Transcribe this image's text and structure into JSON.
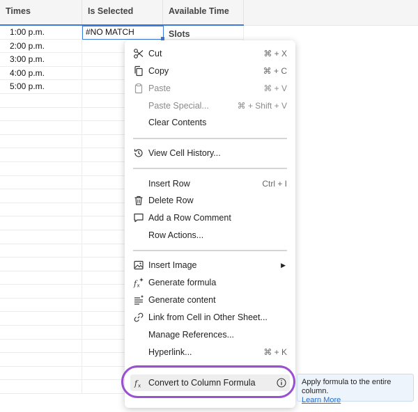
{
  "columns": [
    "Times",
    "Is Selected",
    "Available Time Slots"
  ],
  "rows": [
    {
      "time": "1:00 p.m.",
      "selected": "#NO MATCH",
      "slot": ""
    },
    {
      "time": "2:00 p.m.",
      "selected": "",
      "slot": ""
    },
    {
      "time": "3:00 p.m.",
      "selected": "",
      "slot": ""
    },
    {
      "time": "4:00 p.m.",
      "selected": "",
      "slot": ""
    },
    {
      "time": "5:00 p.m.",
      "selected": "",
      "slot": ""
    }
  ],
  "active_cell": "#NO MATCH",
  "menu": {
    "cut": {
      "label": "Cut",
      "shortcut": "⌘ + X"
    },
    "copy": {
      "label": "Copy",
      "shortcut": "⌘ + C"
    },
    "paste": {
      "label": "Paste",
      "shortcut": "⌘ + V"
    },
    "paste_special": {
      "label": "Paste Special...",
      "shortcut": "⌘ + Shift + V"
    },
    "clear_contents": {
      "label": "Clear Contents"
    },
    "view_history": {
      "label": "View Cell History..."
    },
    "insert_row": {
      "label": "Insert Row",
      "shortcut": "Ctrl + I"
    },
    "delete_row": {
      "label": "Delete Row"
    },
    "add_comment": {
      "label": "Add a Row Comment"
    },
    "row_actions": {
      "label": "Row Actions..."
    },
    "insert_image": {
      "label": "Insert Image",
      "submenu_arrow": "▶"
    },
    "generate_formula": {
      "label": "Generate formula"
    },
    "generate_content": {
      "label": "Generate content"
    },
    "link_cell": {
      "label": "Link from Cell in Other Sheet..."
    },
    "manage_refs": {
      "label": "Manage References..."
    },
    "hyperlink": {
      "label": "Hyperlink...",
      "shortcut": "⌘ + K"
    },
    "convert_formula": {
      "label": "Convert to Column Formula"
    }
  },
  "tooltip": {
    "text": "Apply formula to the entire column.",
    "link": "Learn More"
  },
  "colors": {
    "accent": "#3c7ad9",
    "highlight_ring": "#9b4fd1",
    "tooltip_bg": "#eef4fb",
    "link": "#2b6fca"
  }
}
